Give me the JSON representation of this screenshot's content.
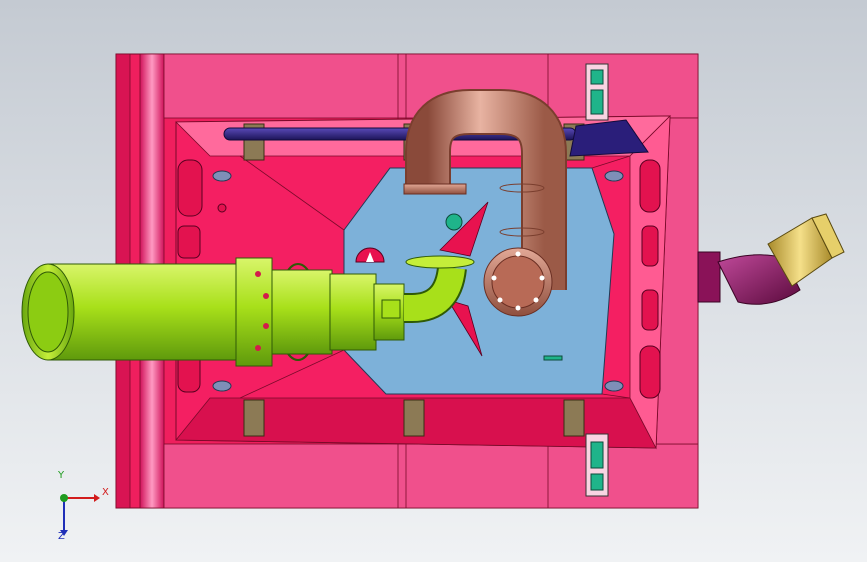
{
  "viewport": {
    "background_top": "#c4cad2",
    "background_bottom": "#f0f2f4"
  },
  "model": {
    "colors": {
      "mold_base": "#ef1f5e",
      "mold_plate": "#f0508c",
      "cavity_floor": "#7db1d9",
      "outlet_pipe": "#b8ec1c",
      "elbow_pipe": "#c97a63",
      "guide_rod": "#3a2a8e",
      "side_fitting": "#8a1258",
      "fitting_ring": "#e0c04a",
      "clamp": "#8c7a55",
      "latch": "#1fb48a"
    }
  },
  "triad": {
    "x_label": "X",
    "y_label": "Y",
    "z_label": "Z"
  }
}
